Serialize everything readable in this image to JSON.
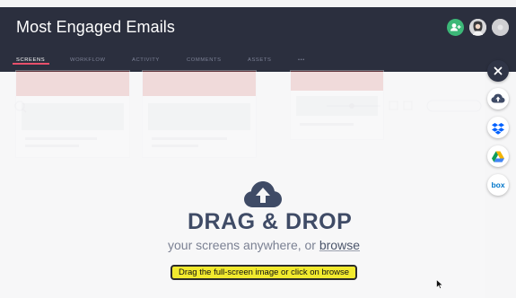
{
  "header": {
    "title": "Most Engaged Emails",
    "tabs": [
      {
        "label": "SCREENS",
        "active": true
      },
      {
        "label": "WORKFLOW",
        "active": false
      },
      {
        "label": "ACTIVITY",
        "active": false
      },
      {
        "label": "COMMENTS",
        "active": false
      },
      {
        "label": "ASSETS",
        "active": false
      },
      {
        "label": "•••",
        "active": false
      }
    ],
    "icons": [
      "add-user-icon",
      "user-avatar-icon",
      "user-avatar-icon"
    ]
  },
  "dropzone": {
    "icon": "cloud-upload-icon",
    "title": "DRAG & DROP",
    "subtitle_prefix": "your screens anywhere, or ",
    "browse_label": "browse"
  },
  "tooltip": {
    "text": "Drag the full-screen image or click on browse"
  },
  "side_buttons": [
    {
      "name": "close-icon"
    },
    {
      "name": "cloud-upload-icon"
    },
    {
      "name": "dropbox-icon"
    },
    {
      "name": "google-drive-icon"
    },
    {
      "name": "box-icon",
      "label": "box"
    }
  ],
  "colors": {
    "header_bg": "#2b2f3e",
    "active_tab_underline": "#e8506b",
    "drop_title": "#3f4b66",
    "tooltip_bg": "#f2ea2e",
    "dropbox": "#0061ff",
    "box": "#0075c9",
    "add_user": "#3cb878"
  }
}
